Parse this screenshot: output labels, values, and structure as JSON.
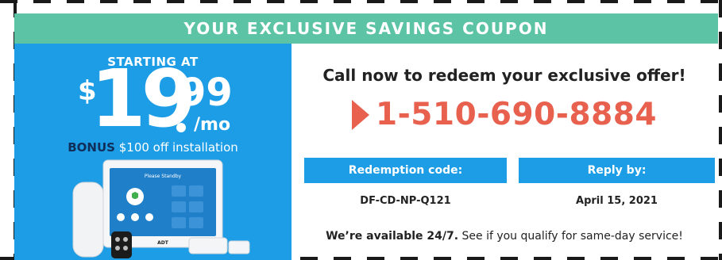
{
  "banner": {
    "title": "YOUR EXCLUSIVE SAVINGS COUPON"
  },
  "promo": {
    "starting_label": "STARTING AT",
    "currency": "$",
    "price_whole": "19",
    "price_cents": "99",
    "price_unit": "/mo",
    "bonus_label": "BONUS",
    "bonus_text": "$100 off installation",
    "product_brand": "ADT",
    "product_screen_title": "Please Standby"
  },
  "offer": {
    "headline": "Call now to redeem your exclusive offer!",
    "phone": "1-510-690-8884",
    "redemption_label": "Redemption code:",
    "redemption_code": "DF-CD-NP-Q121",
    "reply_label": "Reply by:",
    "reply_date": "April 15, 2021",
    "availability_strong": "We’re available 24/7.",
    "availability_text": "See if you qualify for same-day service!"
  },
  "colors": {
    "banner": "#5cc3a4",
    "promo_blue": "#1d9de5",
    "phone_orange": "#e8614e",
    "bonus_navy": "#0f2f5a"
  }
}
